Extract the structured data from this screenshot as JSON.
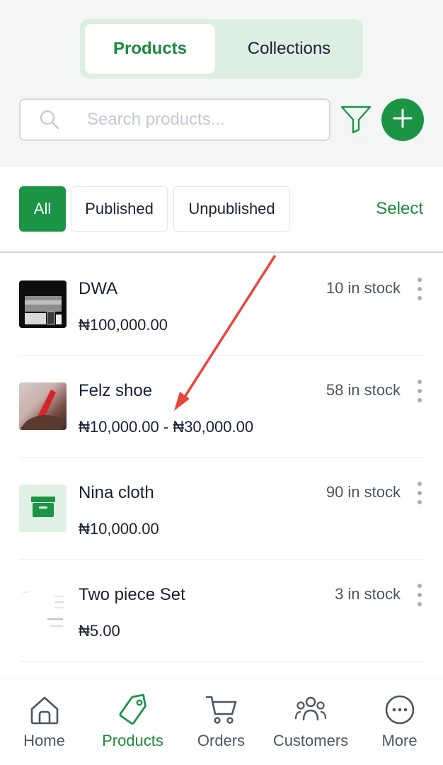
{
  "segmented": {
    "active": "Products",
    "other": "Collections"
  },
  "search": {
    "placeholder": "Search products...",
    "value": ""
  },
  "filters": {
    "all": "All",
    "published": "Published",
    "unpublished": "Unpublished",
    "select": "Select"
  },
  "products": [
    {
      "name": "DWA",
      "price": "₦100,000.00",
      "stock": "10 in stock"
    },
    {
      "name": "Felz shoe",
      "price": "₦10,000.00 - ₦30,000.00",
      "stock": "58 in stock"
    },
    {
      "name": "Nina cloth",
      "price": "₦10,000.00",
      "stock": "90 in stock"
    },
    {
      "name": "Two piece Set",
      "price": "₦5.00",
      "stock": "3 in stock"
    }
  ],
  "nav": {
    "home": "Home",
    "products": "Products",
    "orders": "Orders",
    "customers": "Customers",
    "more": "More"
  },
  "colors": {
    "accent": "#1b9446",
    "accent_text": "#1b8a3c",
    "annotation_arrow": "#e8453c"
  },
  "icons": {
    "search": "search-icon",
    "filter": "filter-icon",
    "add": "plus-icon",
    "more": "vertical-dots-icon"
  }
}
